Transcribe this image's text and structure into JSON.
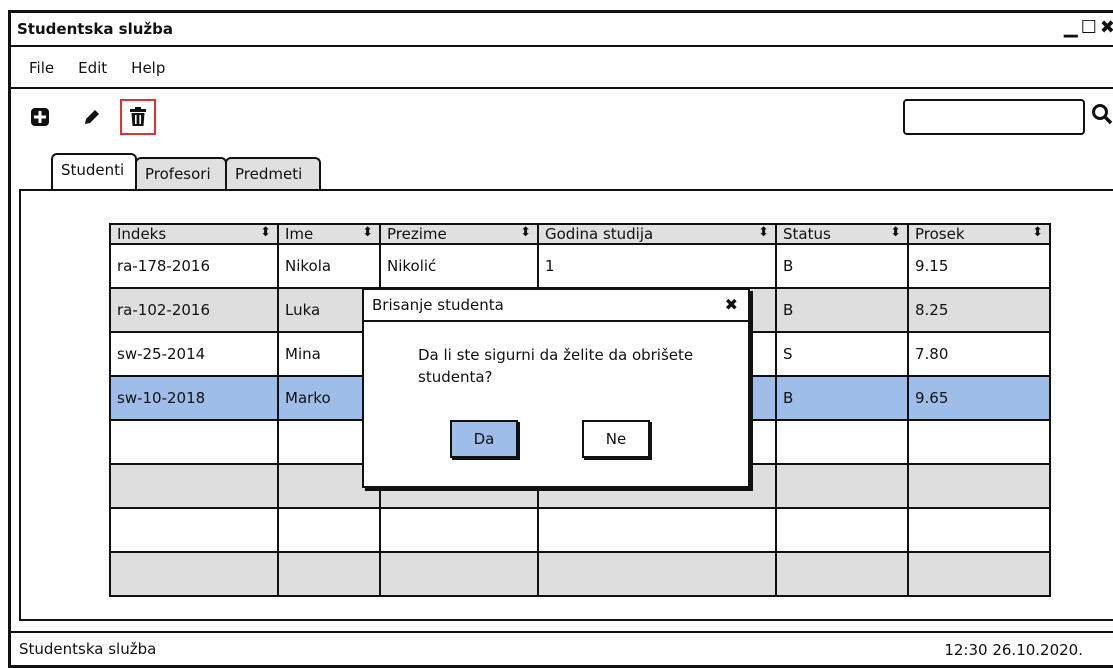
{
  "window": {
    "title": "Studentska služba",
    "controls": [
      "minimize",
      "maximize",
      "close"
    ]
  },
  "menu": {
    "items": [
      "File",
      "Edit",
      "Help"
    ]
  },
  "toolbar": {
    "icons": [
      {
        "name": "add-icon",
        "glyph": "✚"
      },
      {
        "name": "edit-icon",
        "glyph": "✎"
      },
      {
        "name": "trash-icon",
        "glyph": "🗑"
      }
    ],
    "search_icon": "⌕"
  },
  "tabs": [
    {
      "label": "Studenti",
      "active": true
    },
    {
      "label": "Profesori",
      "active": false
    },
    {
      "label": "Predmeti",
      "active": false
    }
  ],
  "table": {
    "columns": [
      "Indeks",
      "Ime",
      "Prezime",
      "Godina studija",
      "Status",
      "Prosek"
    ],
    "rows": [
      [
        "ra-178-2016",
        "Nikola",
        "Nikolić",
        "1",
        "B",
        "9.15"
      ],
      [
        "ra-102-2016",
        "Luka",
        "",
        "",
        "B",
        "8.25"
      ],
      [
        "sw-25-2014",
        "Mina",
        "",
        "",
        "S",
        "7.80"
      ],
      [
        "sw-10-2018",
        "Marko",
        "",
        "",
        "B",
        "9.65"
      ],
      [
        "",
        "",
        "",
        "",
        "",
        ""
      ],
      [
        "",
        "",
        "",
        "",
        "",
        ""
      ],
      [
        "",
        "",
        "",
        "",
        "",
        ""
      ],
      [
        "",
        "",
        "",
        "",
        "",
        ""
      ]
    ],
    "selected_row": 3,
    "sort_glyph": "⬍"
  },
  "dialog": {
    "title": "Brisanje studenta",
    "message": "Da li ste sigurni da želite da obrišete studenta?",
    "yes_label": "Da",
    "no_label": "Ne",
    "close_glyph": "✖"
  },
  "statusbar": {
    "left": "Studentska služba",
    "right": "12:30 26.10.2020."
  },
  "colors": {
    "selected_row": "#9fbde9",
    "alt_row": "#dedede",
    "selected_button": "#9fbde9",
    "highlight_border": "#e03232"
  }
}
